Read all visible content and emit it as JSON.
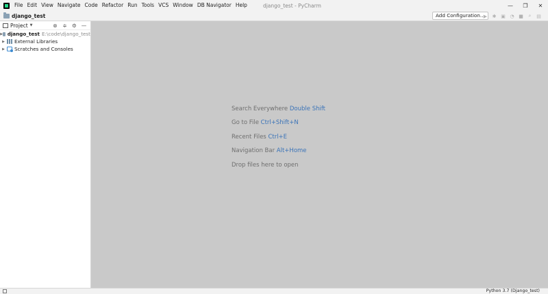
{
  "menu": [
    "File",
    "Edit",
    "View",
    "Navigate",
    "Code",
    "Refactor",
    "Run",
    "Tools",
    "VCS",
    "Window",
    "DB Navigator",
    "Help"
  ],
  "window_title": "django_test - PyCharm",
  "navbar": {
    "project_name": "django_test",
    "add_config_label": "Add Configuration..."
  },
  "window_controls": {
    "minimize": "—",
    "restore": "❐",
    "close": "✕"
  },
  "project_pane": {
    "title": "Project",
    "tree": [
      {
        "label": "django_test",
        "path": "E:\\code\\django_test",
        "icon": "folder-icon"
      },
      {
        "label": "External Libraries",
        "icon": "libraries-icon"
      },
      {
        "label": "Scratches and Consoles",
        "icon": "scratches-icon"
      }
    ]
  },
  "editor_hints": [
    {
      "text": "Search Everywhere ",
      "shortcut": "Double Shift"
    },
    {
      "text": "Go to File ",
      "shortcut": "Ctrl+Shift+N"
    },
    {
      "text": "Recent Files ",
      "shortcut": "Ctrl+E"
    },
    {
      "text": "Navigation Bar ",
      "shortcut": "Alt+Home"
    },
    {
      "text": "Drop files here to open",
      "shortcut": ""
    }
  ],
  "statusbar": {
    "interpreter": "Python 3.7 (Django_test)"
  },
  "colors": {
    "editor_bg": "#c9c9c9",
    "shortcut": "#3a73b8",
    "hint": "#6e6e6e"
  }
}
